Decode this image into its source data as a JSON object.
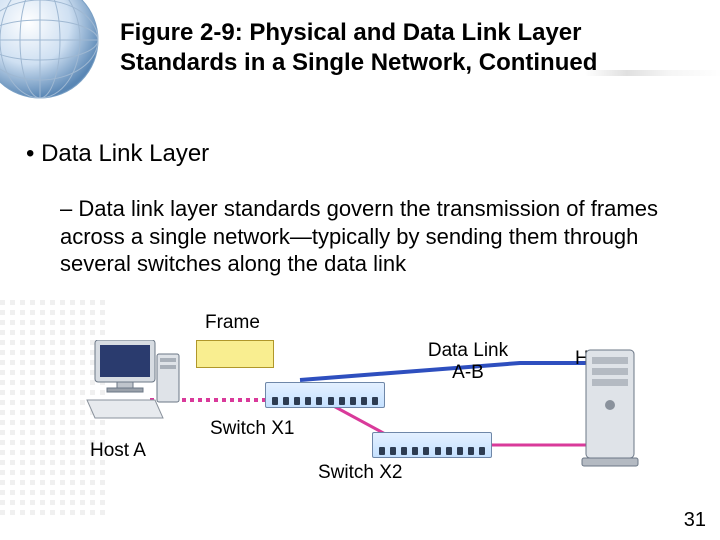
{
  "title": "Figure 2-9: Physical and Data Link Layer Standards in a Single Network, Continued",
  "bullet1": "Data Link Layer",
  "sub_bullet": "Data link layer standards govern the transmission of frames across a single network—typically by sending them through several switches along the data link",
  "labels": {
    "frame": "Frame",
    "host_a": "Host A",
    "host_b": "Host B",
    "data_link_top": "Data Link",
    "data_link_bottom": "A-B",
    "switch_x1": "Switch X1",
    "switch_x2": "Switch X2"
  },
  "page_number": "31",
  "colors": {
    "link_blue": "#2e4fbf",
    "link_magenta": "#d93a9a",
    "frame_fill": "#f9ee90"
  }
}
